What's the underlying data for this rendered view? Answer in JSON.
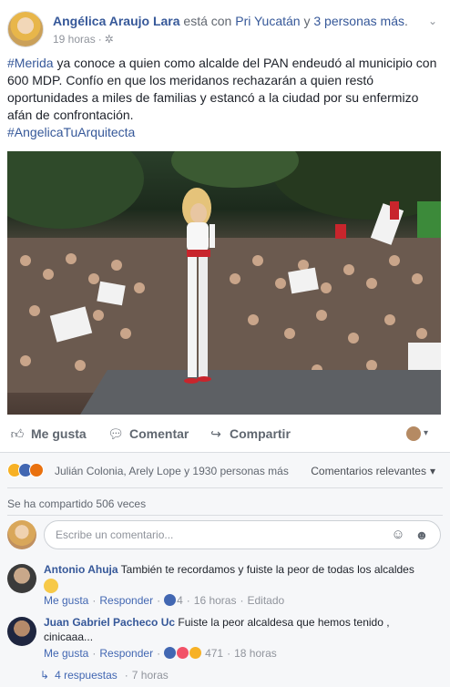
{
  "post": {
    "author": "Angélica Araujo Lara",
    "with_text": " está con ",
    "tagged": "Pri Yucatán",
    "and_text": " y ",
    "others": "3 personas más",
    "period": ".",
    "time": "19 horas",
    "privacy_icon": "gear-icon",
    "hashtag_city": "#Merida",
    "text_main": " ya conoce a quien como alcalde del PAN endeudó al municipio con 600 MDP. Confío en que los meridanos rechazarán a quien restó oportunidades a miles de familias y estancó a la ciudad por su enfermizo afán de confrontación.",
    "hashtag_campaign": "#AngelicaTuArquitecta"
  },
  "actions": {
    "like_label": "Me gusta",
    "comment_label": "Comentar",
    "share_label": "Compartir"
  },
  "reactions": {
    "summary": "Julián Colonia, Arely Lope y 1930 personas más",
    "sort_label": "Comentarios relevantes",
    "shares": "Se ha compartido 506 veces"
  },
  "composer": {
    "placeholder": "Escribe un comentario..."
  },
  "comments": [
    {
      "author": "Antonio Ahuja",
      "text": "También te recordamos y fuiste la peor de todas los alcaldes",
      "like": "Me gusta",
      "reply": "Responder",
      "reactions_count": "4",
      "time": "16 horas",
      "edited": "Editado"
    },
    {
      "author": "Juan Gabriel Pacheco Uc",
      "text": "Fuiste la peor alcaldesa que hemos tenido , cinicaaa...",
      "like": "Me gusta",
      "reply": "Responder",
      "reactions_count": "471",
      "time": "18 horas",
      "replies": "4 respuestas",
      "replies_time": "7 horas"
    }
  ],
  "colors": {
    "link": "#365899",
    "like_blue": "#4267b2",
    "haha_yellow": "#f7b125",
    "angry_orange": "#e9710f",
    "love_red": "#f25268"
  }
}
